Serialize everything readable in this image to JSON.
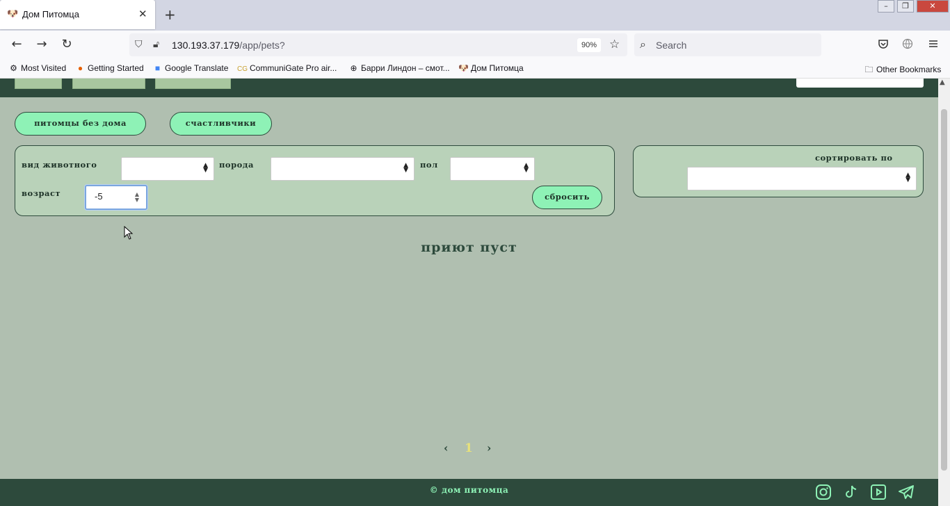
{
  "browser": {
    "tab_title": "Дом Питомца",
    "url_host": "130.193.37.179",
    "url_path": "/app/pets?",
    "zoom": "90%",
    "search_placeholder": "Search",
    "bookmarks": [
      {
        "label": "Most Visited",
        "icon": "gear-icon"
      },
      {
        "label": "Getting Started",
        "icon": "firefox-icon"
      },
      {
        "label": "Google Translate",
        "icon": "translate-icon"
      },
      {
        "label": "CommuniGate Pro air...",
        "icon": "cg-icon"
      },
      {
        "label": "Барри Линдон – смот...",
        "icon": "globe-icon"
      },
      {
        "label": "Дом Питомца",
        "icon": "dog-icon"
      }
    ],
    "other_bookmarks": "Other Bookmarks"
  },
  "page": {
    "pill_homeless": "питомцы без дома",
    "pill_lucky": "счастливчики",
    "filters": {
      "species_label": "вид животного",
      "breed_label": "порода",
      "sex_label": "пол",
      "age_label": "возраст",
      "age_value": "-5",
      "reset_label": "сбросить"
    },
    "sort": {
      "label": "сортировать по"
    },
    "empty_message": "приют пуст",
    "pagination": {
      "prev": "‹",
      "current": "1",
      "next": "›"
    },
    "footer_text": "© дом питомца",
    "social_icons": [
      "instagram-icon",
      "tiktok-icon",
      "youtube-icon",
      "telegram-icon"
    ]
  }
}
